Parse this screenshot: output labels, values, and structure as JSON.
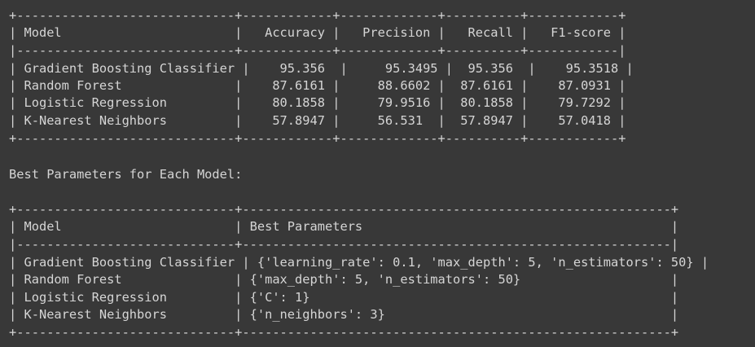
{
  "metrics_table": {
    "lines": [
      "+-----------------------------+------------+-------------+----------+------------+",
      "| Model                       |   Accuracy |   Precision |   Recall |   F1-score |",
      "|-----------------------------+------------+-------------+----------+------------|",
      "| Gradient Boosting Classifier |    95.356  |     95.3495 |  95.356  |    95.3518 |",
      "| Random Forest               |    87.6161 |     88.6602 |  87.6161 |    87.0931 |",
      "| Logistic Regression         |    80.1858 |     79.9516 |  80.1858 |    79.7292 |",
      "| K-Nearest Neighbors         |    57.8947 |     56.531  |  57.8947 |    57.0418 |",
      "+-----------------------------+------------+-------------+----------+------------+"
    ]
  },
  "params_heading": "Best Parameters for Each Model:",
  "params_table": {
    "lines": [
      "+-----------------------------+---------------------------------------------------------+",
      "| Model                       | Best Parameters                                         |",
      "|-----------------------------+---------------------------------------------------------|",
      "| Gradient Boosting Classifier | {'learning_rate': 0.1, 'max_depth': 5, 'n_estimators': 50} |",
      "| Random Forest               | {'max_depth': 5, 'n_estimators': 50}                    |",
      "| Logistic Regression         | {'C': 1}                                                |",
      "| K-Nearest Neighbors         | {'n_neighbors': 3}                                      |",
      "+-----------------------------+---------------------------------------------------------+"
    ]
  }
}
